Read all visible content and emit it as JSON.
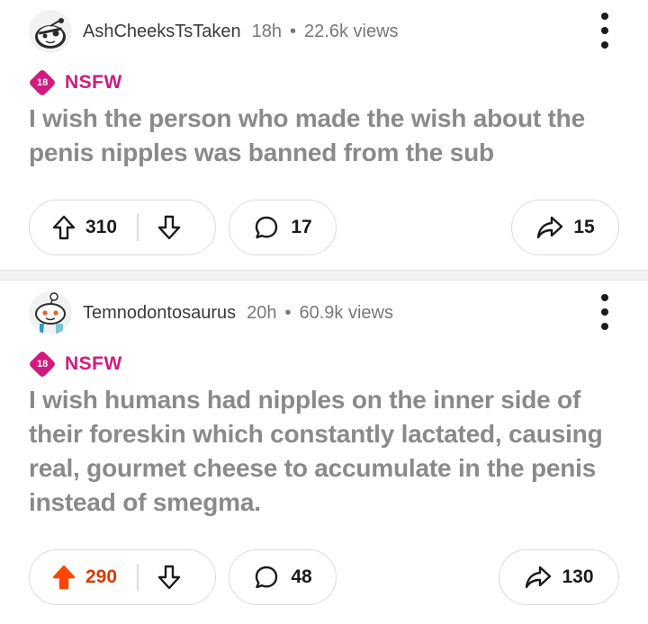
{
  "colors": {
    "nsfw": "#d4197e",
    "upvoted": "#ff4500",
    "title": "#8a8a8a"
  },
  "posts": [
    {
      "author": "AshCheeksTsTaken",
      "age": "18h",
      "separator": "•",
      "views": "22.6k views",
      "nsfw_badge": "18",
      "nsfw_label": "NSFW",
      "title": "I wish the person who made the wish about the penis nipples was banned from the sub",
      "upvotes": "310",
      "upvoted": false,
      "comments": "17",
      "shares": "15",
      "avatar_icon": "snoo-eyepatch-avatar-icon"
    },
    {
      "author": "Temnodontosaurus",
      "age": "20h",
      "separator": "•",
      "views": "60.9k views",
      "nsfw_badge": "18",
      "nsfw_label": "NSFW",
      "title": "I wish humans had nipples on the inner side of their foreskin which constantly lactated, causing real, gourmet cheese to accumulate in the penis instead of smegma.",
      "upvotes": "290",
      "upvoted": true,
      "comments": "48",
      "shares": "130",
      "avatar_icon": "snoo-doctor-avatar-icon"
    }
  ]
}
